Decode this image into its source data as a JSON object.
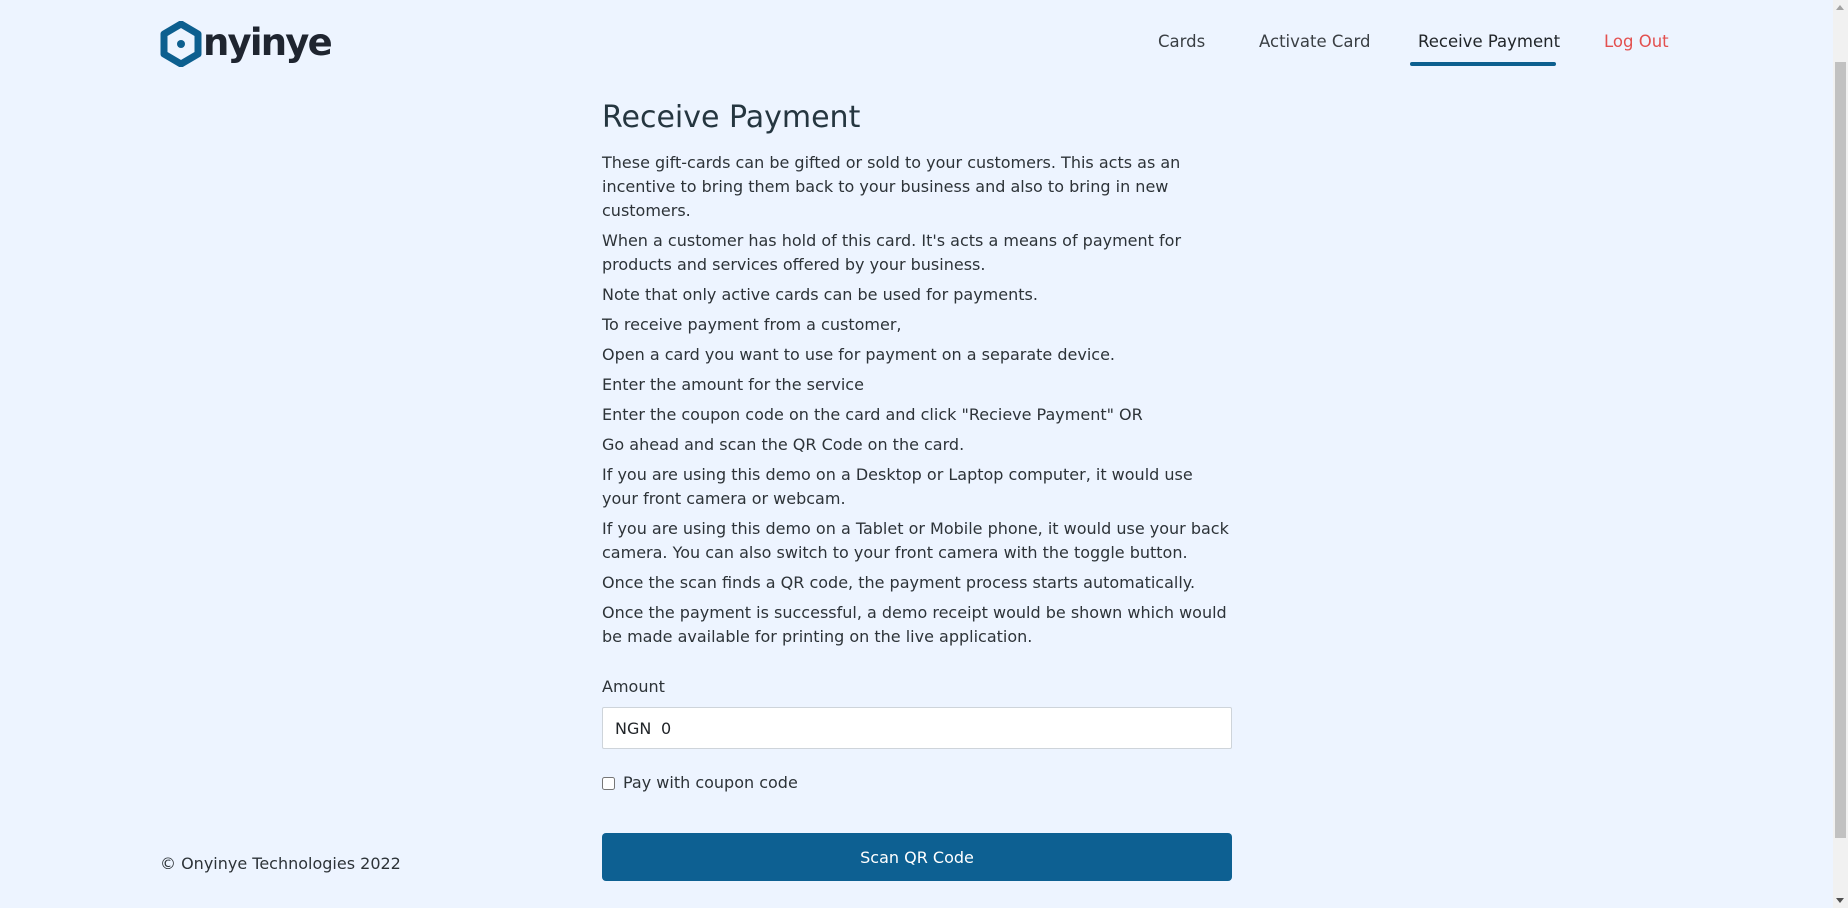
{
  "brand": {
    "name": "Onyinye",
    "logo_text": "nyinye",
    "logo_icon": "hexagon-o-icon",
    "color": "#0d5f8f"
  },
  "nav": {
    "items": [
      {
        "label": "Cards"
      },
      {
        "label": "Activate Card"
      },
      {
        "label": "Receive Payment",
        "active": true
      },
      {
        "label": "Log Out"
      }
    ],
    "active_color": "#0d5f8f",
    "logout_color": "#e3504f"
  },
  "main": {
    "title": "Receive Payment",
    "paragraphs": [
      "These gift-cards can be gifted or sold to your customers. This acts as an incentive to bring them back to your business and also to bring in new customers.",
      "When a customer has hold of this card. It's acts a means of payment for products and services offered by your business.",
      "Note that only active cards can be used for payments.",
      "To receive payment from a customer,",
      "Open a card you want to use for payment on a separate device.",
      "Enter the amount for the service",
      "Enter the coupon code on the card and click \"Recieve Payment\" OR",
      "Go ahead and scan the QR Code on the card.",
      "If you are using this demo on a Desktop or Laptop computer, it would use your front camera or webcam.",
      "If you are using this demo on a Tablet or Mobile phone, it would use your back camera. You can also switch to your front camera with the toggle button.",
      "Once the scan finds a QR code, the payment process starts automatically.",
      "Once the payment is successful, a demo receipt would be shown which would be made available for printing on the live application."
    ]
  },
  "form": {
    "amount_label": "Amount",
    "currency": "NGN",
    "amount_value": "0",
    "coupon_checkbox_label": "Pay with coupon code",
    "coupon_checked": false,
    "scan_button_label": "Scan QR Code",
    "button_color": "#0d6092"
  },
  "footer": {
    "text": "© Onyinye Technologies 2022"
  }
}
